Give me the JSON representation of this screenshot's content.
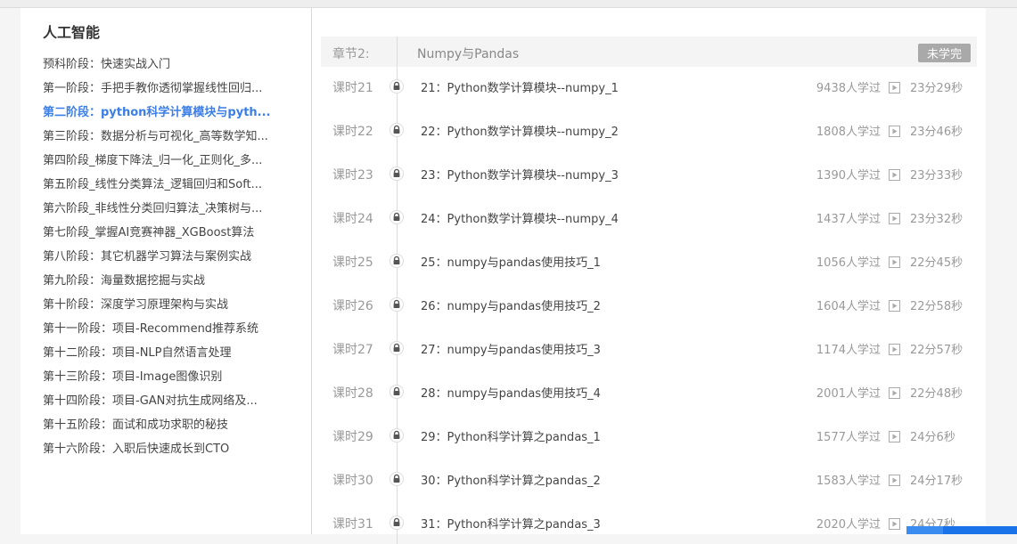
{
  "sidebar": {
    "title": "人工智能",
    "stages": [
      {
        "label": "预科阶段：快速实战入门"
      },
      {
        "label": "第一阶段：手把手教你透彻掌握线性回归..."
      },
      {
        "label": "第二阶段：python科学计算模块与pyth...",
        "active": true
      },
      {
        "label": "第三阶段：数据分析与可视化_高等数学知..."
      },
      {
        "label": "第四阶段_梯度下降法_归一化_正则化_多..."
      },
      {
        "label": "第五阶段_线性分类算法_逻辑回归和Soft..."
      },
      {
        "label": "第六阶段_非线性分类回归算法_决策树与..."
      },
      {
        "label": "第七阶段_掌握AI竞赛神器_XGBoost算法"
      },
      {
        "label": "第八阶段：其它机器学习算法与案例实战"
      },
      {
        "label": "第九阶段：海量数据挖掘与实战"
      },
      {
        "label": "第十阶段：深度学习原理架构与实战"
      },
      {
        "label": "第十一阶段：项目-Recommend推荐系统"
      },
      {
        "label": "第十二阶段：项目-NLP自然语言处理"
      },
      {
        "label": "第十三阶段：项目-Image图像识别"
      },
      {
        "label": "第十四阶段：项目-GAN对抗生成网络及..."
      },
      {
        "label": "第十五阶段：面试和成功求职的秘技"
      },
      {
        "label": "第十六阶段：入职后快速成长到CTO"
      }
    ]
  },
  "chapter": {
    "label": "章节2:",
    "name": "Numpy与Pandas",
    "status": "未学完"
  },
  "lessons": [
    {
      "no": "课时21",
      "title": "21：Python数学计算模块--numpy_1",
      "learners": "9438人学过",
      "duration": "23分29秒"
    },
    {
      "no": "课时22",
      "title": "22：Python数学计算模块--numpy_2",
      "learners": "1808人学过",
      "duration": "23分46秒"
    },
    {
      "no": "课时23",
      "title": "23：Python数学计算模块--numpy_3",
      "learners": "1390人学过",
      "duration": "23分33秒"
    },
    {
      "no": "课时24",
      "title": "24：Python数学计算模块--numpy_4",
      "learners": "1437人学过",
      "duration": "23分32秒"
    },
    {
      "no": "课时25",
      "title": "25：numpy与pandas使用技巧_1",
      "learners": "1056人学过",
      "duration": "22分45秒"
    },
    {
      "no": "课时26",
      "title": "26：numpy与pandas使用技巧_2",
      "learners": "1604人学过",
      "duration": "22分58秒"
    },
    {
      "no": "课时27",
      "title": "27：numpy与pandas使用技巧_3",
      "learners": "1174人学过",
      "duration": "22分57秒"
    },
    {
      "no": "课时28",
      "title": "28：numpy与pandas使用技巧_4",
      "learners": "2001人学过",
      "duration": "22分48秒"
    },
    {
      "no": "课时29",
      "title": "29：Python科学计算之pandas_1",
      "learners": "1577人学过",
      "duration": "24分6秒"
    },
    {
      "no": "课时30",
      "title": "30：Python科学计算之pandas_2",
      "learners": "1583人学过",
      "duration": "24分17秒"
    },
    {
      "no": "课时31",
      "title": "31：Python科学计算之pandas_3",
      "learners": "2020人学过",
      "duration": "24分7秒"
    }
  ],
  "colors": {
    "accent": "#3b7ee8",
    "badge": "#a9a9a9",
    "muted": "#999999"
  },
  "icons": {
    "lock": "lock-icon",
    "play": "play-icon"
  }
}
